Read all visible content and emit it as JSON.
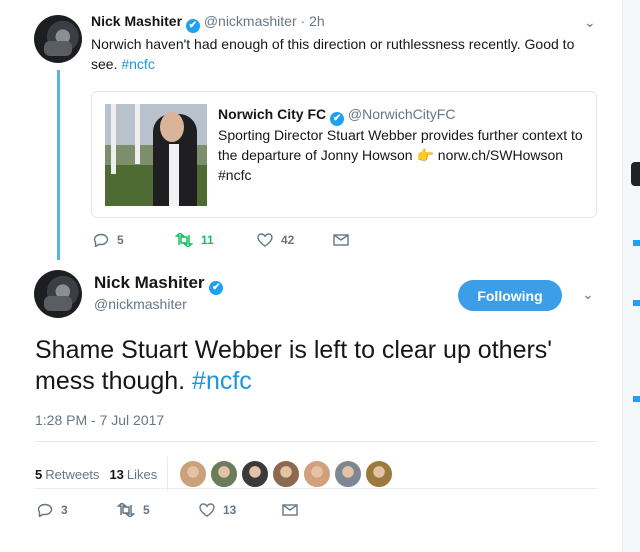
{
  "thread": {
    "parent": {
      "name": "Nick Mashiter",
      "handle": "@nickmashiter",
      "time": "· 2h",
      "text": "Norwich haven't had enough of this direction or ruthlessness recently. Good to see.",
      "hashtag": "#ncfc",
      "replies": "5",
      "retweets": "11",
      "likes": "42"
    },
    "quoted": {
      "name": "Norwich City FC",
      "handle": "@NorwichCityFC",
      "text_before": "Sporting Director Stuart Webber provides further context to the departure of Jonny Howson",
      "emoji": "👉",
      "link": "norw.ch/SWHowson",
      "hashtag": "#ncfc"
    }
  },
  "main_tweet": {
    "name": "Nick Mashiter",
    "handle": "@nickmashiter",
    "follow_label": "Following",
    "text": "Shame Stuart Webber is left to clear up others' mess though.",
    "hashtag": "#ncfc",
    "timestamp": "1:28 PM - 7 Jul 2017",
    "retweets_count": "5",
    "retweets_label": "Retweets",
    "likes_count": "13",
    "likes_label": "Likes",
    "replies": "3",
    "retweets": "5",
    "likes": "13"
  },
  "icons": {
    "verified": "✔",
    "reply": "reply-icon",
    "retweet": "retweet-icon",
    "like": "heart-icon",
    "dm": "envelope-icon",
    "chevron": "chevron-down-icon"
  },
  "colors": {
    "accent": "#1da1f2",
    "following_button": "#3b9ee6",
    "retweet_active": "#17bf63",
    "thread_line": "#55b4ea",
    "hashtag": "#1b95e0"
  },
  "likers": [
    {
      "name": "liker-1",
      "color": "#c9a27a"
    },
    {
      "name": "liker-2",
      "color": "#6b7b5c"
    },
    {
      "name": "liker-3",
      "color": "#3a3a3a"
    },
    {
      "name": "liker-4",
      "color": "#8c6a4f"
    },
    {
      "name": "liker-5",
      "color": "#d2a07c"
    },
    {
      "name": "liker-6",
      "color": "#7d8892"
    },
    {
      "name": "liker-7",
      "color": "#9a7b3c"
    }
  ]
}
